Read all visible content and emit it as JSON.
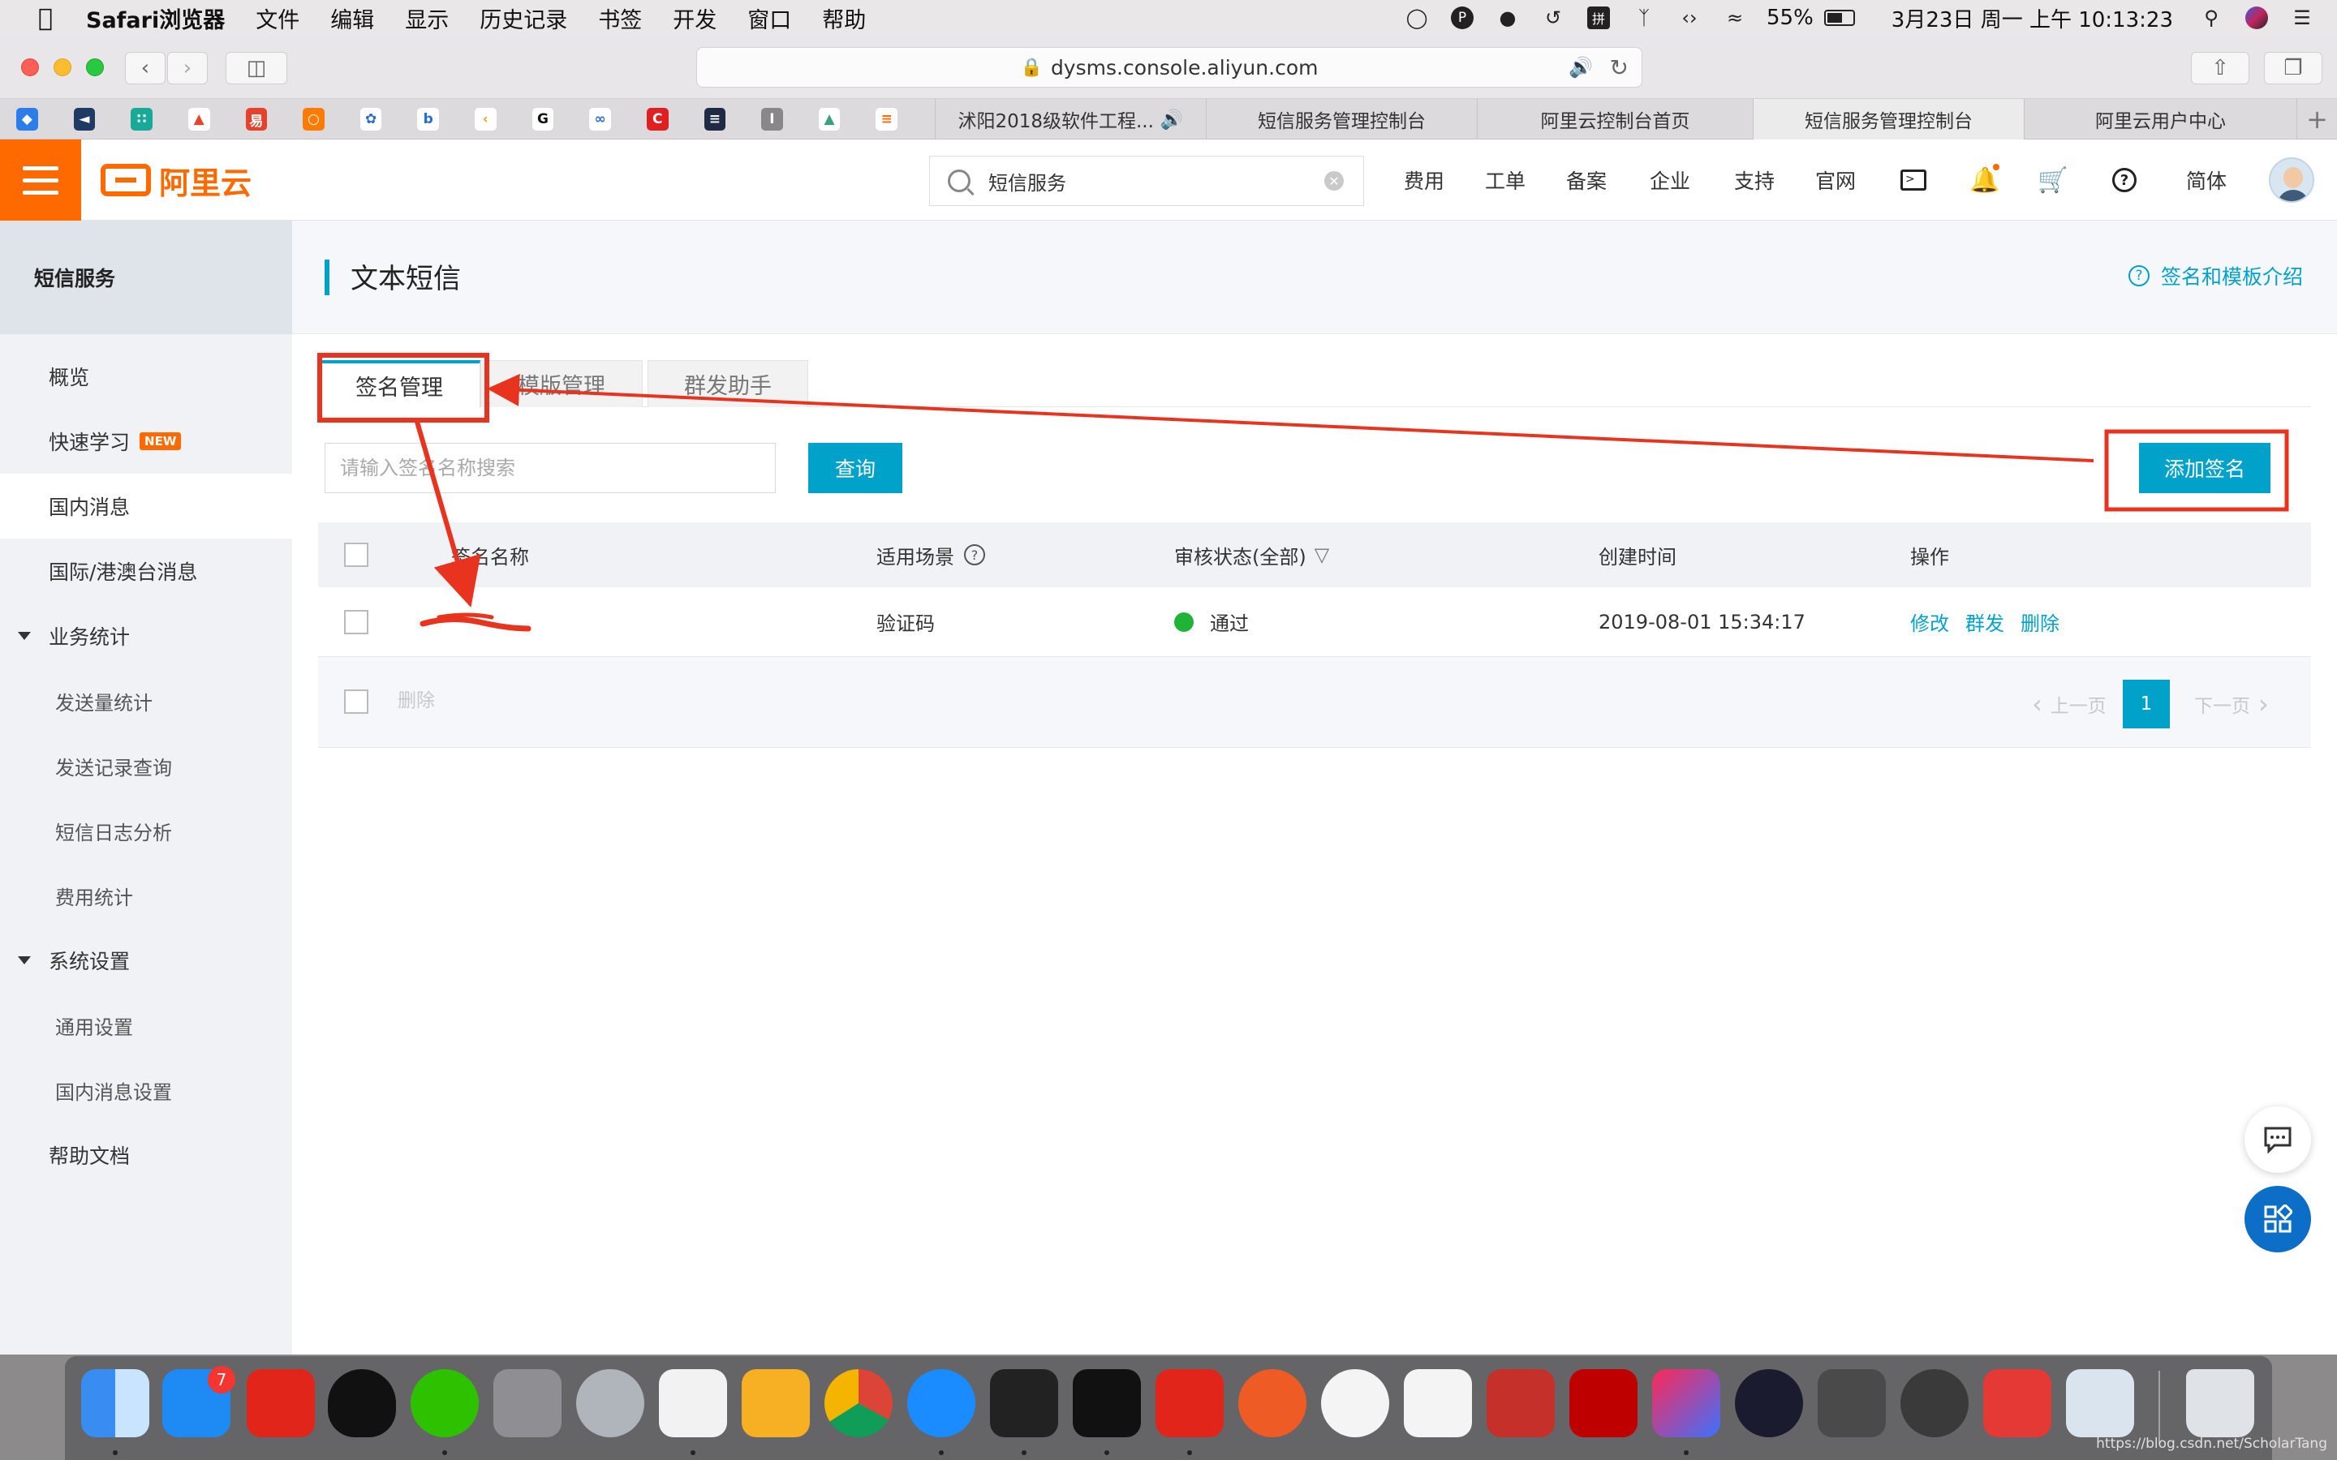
{
  "menubar": {
    "app": "Safari浏览器",
    "menus": [
      "文件",
      "编辑",
      "显示",
      "历史记录",
      "书签",
      "开发",
      "窗口",
      "帮助"
    ],
    "battery": "55%",
    "datetime": "3月23日 周一 上午 10:13:23"
  },
  "browser": {
    "url": "dysms.console.aliyun.com",
    "tabs": [
      {
        "label": "沭阳2018级软件工程..."
      },
      {
        "label": "短信服务管理控制台"
      },
      {
        "label": "阿里云控制台首页"
      },
      {
        "label": "短信服务管理控制台"
      },
      {
        "label": "阿里云用户中心"
      }
    ],
    "active_tab": 3
  },
  "header": {
    "logo_text": "阿里云",
    "search_value": "短信服务",
    "nav": [
      "费用",
      "工单",
      "备案",
      "企业",
      "支持",
      "官网"
    ],
    "lang": "简体",
    "brand_color": "#ff6a00"
  },
  "sidebar": {
    "title": "短信服务",
    "items": [
      {
        "label": "概览"
      },
      {
        "label": "快速学习",
        "badge": "NEW"
      },
      {
        "label": "国内消息"
      },
      {
        "label": "国际/港澳台消息"
      }
    ],
    "groups": [
      {
        "label": "业务统计",
        "children": [
          "发送量统计",
          "发送记录查询",
          "短信日志分析",
          "费用统计"
        ]
      },
      {
        "label": "系统设置",
        "children": [
          "通用设置",
          "国内消息设置"
        ]
      }
    ],
    "footer": "帮助文档"
  },
  "page": {
    "title": "文本短信",
    "help_link": "签名和模板介绍",
    "tabs": [
      "签名管理",
      "模版管理",
      "群发助手"
    ],
    "active_tab": 0,
    "search_placeholder": "请输入签名名称搜索",
    "query_button": "查询",
    "add_button": "添加签名",
    "accent": "#00a2ca"
  },
  "table": {
    "columns": [
      "签名名称",
      "适用场景",
      "审核状态(全部)",
      "创建时间",
      "操作"
    ],
    "rows": [
      {
        "scene": "验证码",
        "status": "通过",
        "created": "2019-08-01 15:34:17",
        "actions": [
          "修改",
          "群发",
          "删除"
        ]
      }
    ],
    "delete_button": "删除",
    "pager": {
      "prev": "上一页",
      "current": "1",
      "next": "下一页"
    }
  },
  "dock": {
    "appstore_badge": "7"
  },
  "watermark": "https://blog.csdn.net/ScholarTang"
}
